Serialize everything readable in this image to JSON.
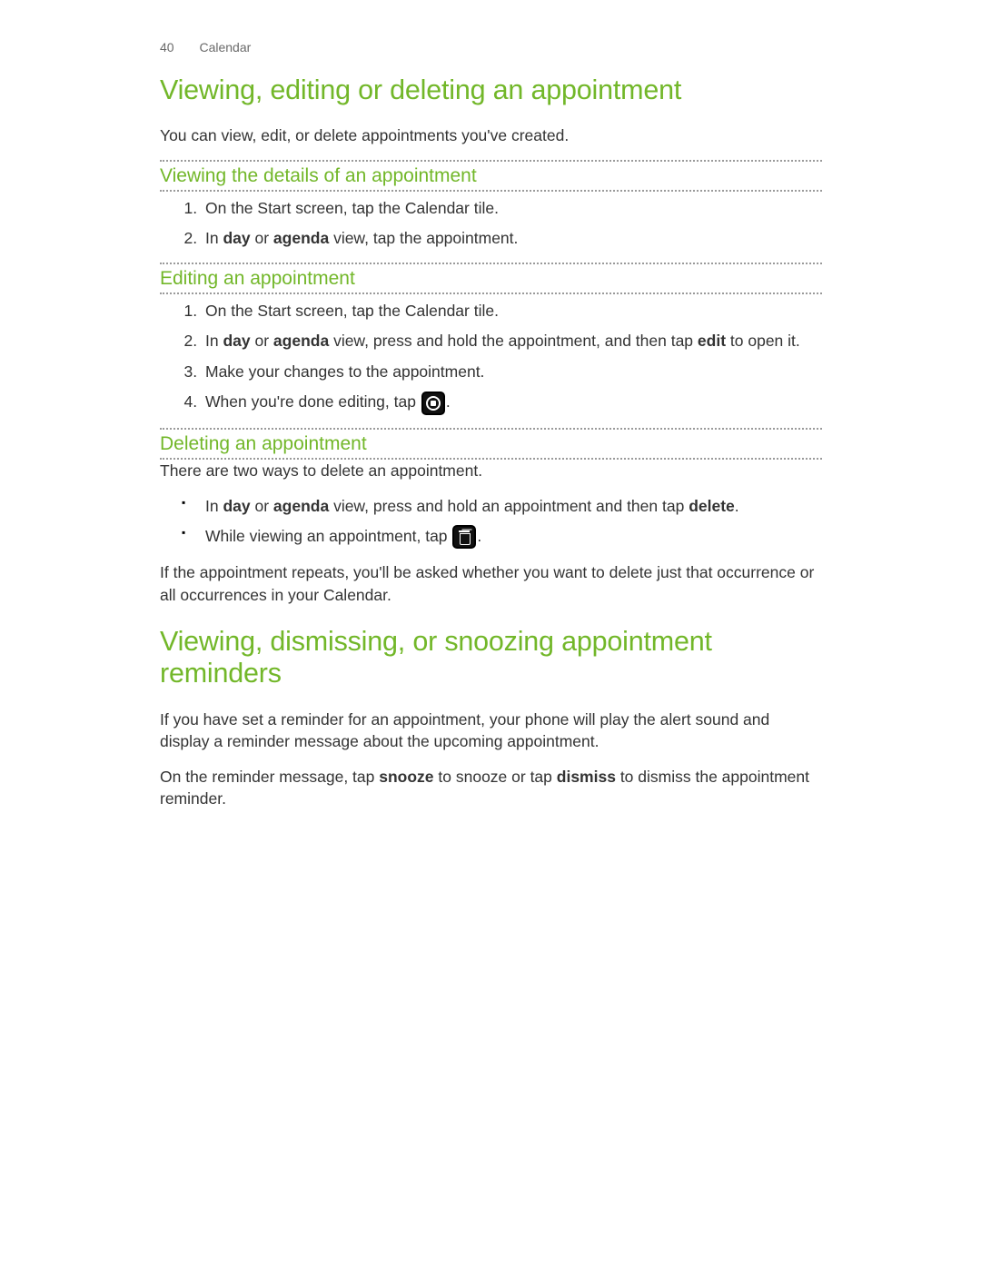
{
  "header": {
    "page_num": "40",
    "section": "Calendar"
  },
  "section1": {
    "title": "Viewing, editing or deleting an appointment",
    "intro": "You can view, edit, or delete appointments you've created.",
    "sub1": {
      "heading": "Viewing the details of an appointment",
      "step1": "On the Start screen, tap the Calendar tile.",
      "step2_pre": "In ",
      "step2_b1": "day",
      "step2_mid1": " or ",
      "step2_b2": "agenda",
      "step2_post": " view, tap the appointment."
    },
    "sub2": {
      "heading": "Editing an appointment",
      "step1": "On the Start screen, tap the Calendar tile.",
      "step2_pre": "In ",
      "step2_b1": "day",
      "step2_mid1": " or ",
      "step2_b2": "agenda",
      "step2_mid2": " view, press and hold the appointment, and then tap ",
      "step2_b3": "edit",
      "step2_post": " to open it.",
      "step3": "Make your changes to the appointment.",
      "step4_pre": "When you're done editing, tap ",
      "step4_post": "."
    },
    "sub3": {
      "heading": "Deleting an appointment",
      "intro": "There are two ways to delete an appointment.",
      "b1_pre": "In ",
      "b1_b1": "day",
      "b1_mid1": " or ",
      "b1_b2": "agenda",
      "b1_mid2": " view, press and hold an appointment and then tap ",
      "b1_b3": "delete",
      "b1_post": ".",
      "b2_pre": "While viewing an appointment, tap ",
      "b2_post": ".",
      "outro": "If the appointment repeats, you'll be asked whether you want to delete just that occurrence or all occurrences in your Calendar."
    }
  },
  "section2": {
    "title": "Viewing, dismissing, or snoozing appointment reminders",
    "p1": "If you have set a reminder for an appointment, your phone will play the alert sound and display a reminder message about the upcoming appointment.",
    "p2_pre": "On the reminder message, tap ",
    "p2_b1": "snooze",
    "p2_mid1": " to snooze or tap ",
    "p2_b2": "dismiss",
    "p2_post": " to dismiss the appointment reminder."
  }
}
